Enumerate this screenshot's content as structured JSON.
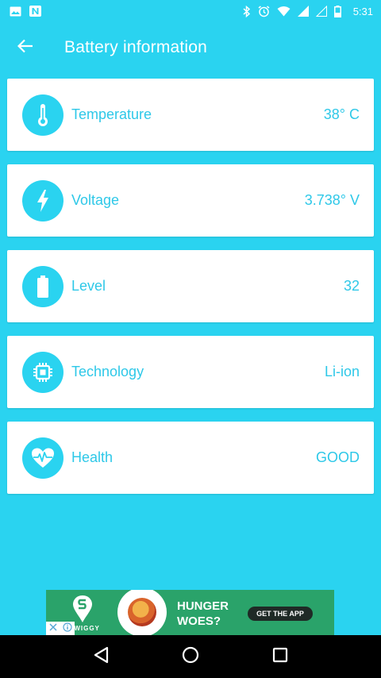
{
  "status_bar": {
    "time": "5:31",
    "left_icons": [
      "image-icon",
      "n-icon"
    ],
    "right_icons": [
      "bluetooth-icon",
      "alarm-icon",
      "wifi-icon",
      "signal-icon",
      "signal-empty-icon",
      "battery-icon"
    ]
  },
  "app_bar": {
    "title": "Battery information",
    "back_icon": "arrow-back-icon"
  },
  "items": [
    {
      "label": "Temperature",
      "value": "38° C",
      "icon": "thermometer-icon"
    },
    {
      "label": "Voltage",
      "value": "3.738° V",
      "icon": "lightning-icon"
    },
    {
      "label": "Level",
      "value": "32",
      "icon": "battery-icon"
    },
    {
      "label": "Technology",
      "value": "Li-ion",
      "icon": "chip-icon"
    },
    {
      "label": "Health",
      "value": "GOOD",
      "icon": "heart-pulse-icon"
    }
  ],
  "ad": {
    "brand": "SWIGGY",
    "headline_line1": "HUNGER",
    "headline_line2": "WOES?",
    "cta": "GET THE APP"
  },
  "colors": {
    "background": "#2ad3f0",
    "card": "#ffffff",
    "text_accent": "#2ec8e8",
    "ad_green": "#2aa36a",
    "nav_bar": "#000000"
  }
}
